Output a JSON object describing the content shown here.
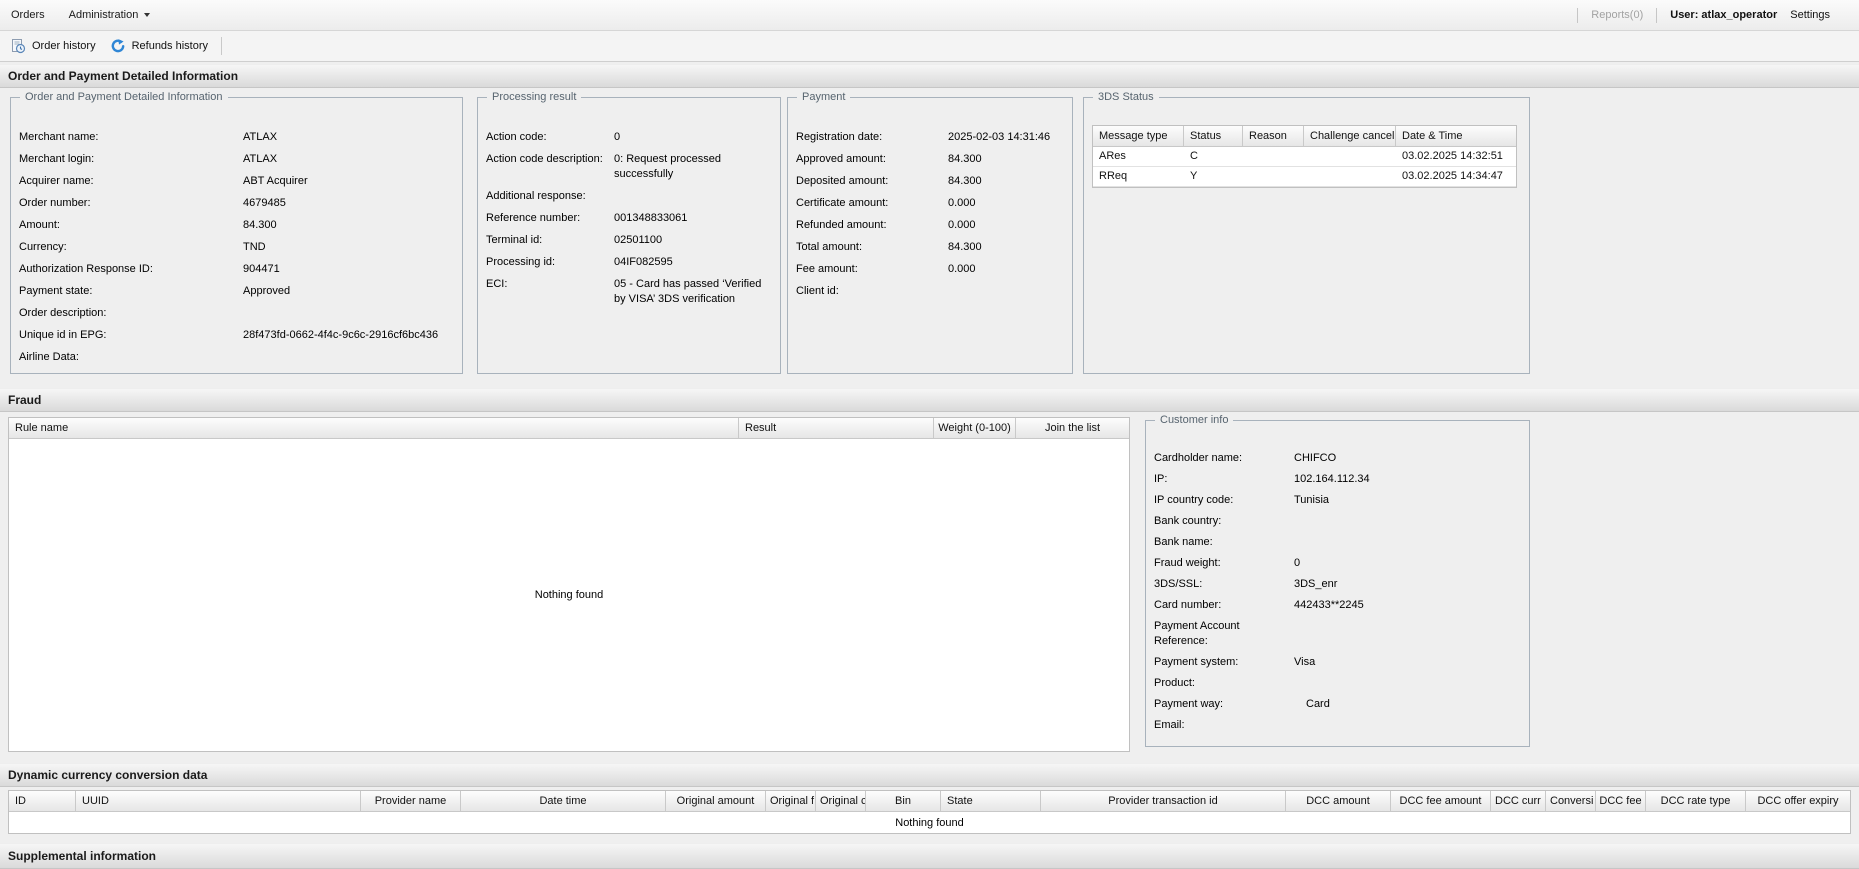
{
  "menubar": {
    "orders_label": "Orders",
    "administration_label": "Administration",
    "reports_label": "Reports(0)",
    "user_label": "User: atlax_operator",
    "settings_label": "Settings"
  },
  "toolbar": {
    "order_history_label": "Order history",
    "refunds_history_label": "Refunds history"
  },
  "section_titles": {
    "main": "Order and Payment Detailed Information",
    "fraud": "Fraud",
    "dcc": "Dynamic currency conversion data",
    "supplemental": "Supplemental information"
  },
  "order_info": {
    "legend": "Order and Payment Detailed Information",
    "rows": [
      {
        "label": "Merchant name:",
        "value": "ATLAX"
      },
      {
        "label": "Merchant login:",
        "value": "ATLAX"
      },
      {
        "label": "Acquirer name:",
        "value": "ABT Acquirer"
      },
      {
        "label": "Order number:",
        "value": "4679485"
      },
      {
        "label": "Amount:",
        "value": "84.300"
      },
      {
        "label": "Currency:",
        "value": "TND"
      },
      {
        "label": "Authorization Response ID:",
        "value": "904471"
      },
      {
        "label": "Payment state:",
        "value": "Approved"
      },
      {
        "label": "Order description:",
        "value": ""
      },
      {
        "label": "Unique id in EPG:",
        "value": "28f473fd-0662-4f4c-9c6c-2916cf6bc436"
      },
      {
        "label": "Airline Data:",
        "value": ""
      }
    ]
  },
  "processing_result": {
    "legend": "Processing result",
    "rows": [
      {
        "label": "Action code:",
        "value": "0"
      },
      {
        "label": "Action code description:",
        "value": "0: Request processed successfully"
      },
      {
        "label": "Additional response:",
        "value": ""
      },
      {
        "label": "Reference number:",
        "value": "001348833061"
      },
      {
        "label": "Terminal id:",
        "value": "02501100"
      },
      {
        "label": "Processing id:",
        "value": "04IF082595"
      },
      {
        "label": "ECI:",
        "value": "05 - Card has passed ‘Verified by VISA’ 3DS verification"
      }
    ]
  },
  "payment": {
    "legend": "Payment",
    "rows": [
      {
        "label": "Registration date:",
        "value": "2025-02-03 14:31:46"
      },
      {
        "label": "Approved amount:",
        "value": "84.300"
      },
      {
        "label": "Deposited amount:",
        "value": "84.300"
      },
      {
        "label": "Certificate amount:",
        "value": "0.000"
      },
      {
        "label": "Refunded amount:",
        "value": "0.000"
      },
      {
        "label": "Total amount:",
        "value": "84.300"
      },
      {
        "label": "Fee amount:",
        "value": "0.000"
      },
      {
        "label": "Client id:",
        "value": ""
      }
    ]
  },
  "threeds": {
    "legend": "3DS Status",
    "columns": [
      "Message type",
      "Status",
      "Reason",
      "Challenge cancel",
      "Date & Time"
    ],
    "rows": [
      {
        "type": "ARes",
        "status": "C",
        "reason": "",
        "challenge": "",
        "datetime": "03.02.2025 14:32:51"
      },
      {
        "type": "RReq",
        "status": "Y",
        "reason": "",
        "challenge": "",
        "datetime": "03.02.2025 14:34:47"
      }
    ]
  },
  "fraud": {
    "columns": [
      "Rule name",
      "Result",
      "Weight (0-100)",
      "Join the list"
    ],
    "empty_text": "Nothing found"
  },
  "customer_info": {
    "legend": "Customer info",
    "rows": [
      {
        "label": "Cardholder name:",
        "value": "CHIFCO"
      },
      {
        "label": "IP:",
        "value": "102.164.112.34"
      },
      {
        "label": "IP country code:",
        "value": "Tunisia"
      },
      {
        "label": "Bank country:",
        "value": ""
      },
      {
        "label": "Bank name:",
        "value": ""
      },
      {
        "label": "Fraud weight:",
        "value": "0"
      },
      {
        "label": "3DS/SSL:",
        "value": "3DS_enr"
      },
      {
        "label": "Card number:",
        "value": "442433**2245"
      },
      {
        "label": "Payment Account Reference:",
        "value": ""
      },
      {
        "label": "Payment system:",
        "value": "Visa"
      },
      {
        "label": "Product:",
        "value": ""
      },
      {
        "label": "Payment way:",
        "value": "Card",
        "value_class": "indent"
      },
      {
        "label": "Email:",
        "value": ""
      }
    ]
  },
  "dcc": {
    "columns": [
      "ID",
      "UUID",
      "Provider name",
      "Date time",
      "Original amount",
      "Original f",
      "Original c",
      "Bin",
      "State",
      "Provider transaction id",
      "DCC amount",
      "DCC fee amount",
      "DCC curr",
      "Conversi",
      "DCC fee",
      "DCC rate type",
      "DCC offer expiry"
    ],
    "empty_text": "Nothing found"
  },
  "colors": {
    "accent_blue": "#2f86d5",
    "legend_gray": "#57646f",
    "disabled_gray": "#a2a2a2"
  }
}
